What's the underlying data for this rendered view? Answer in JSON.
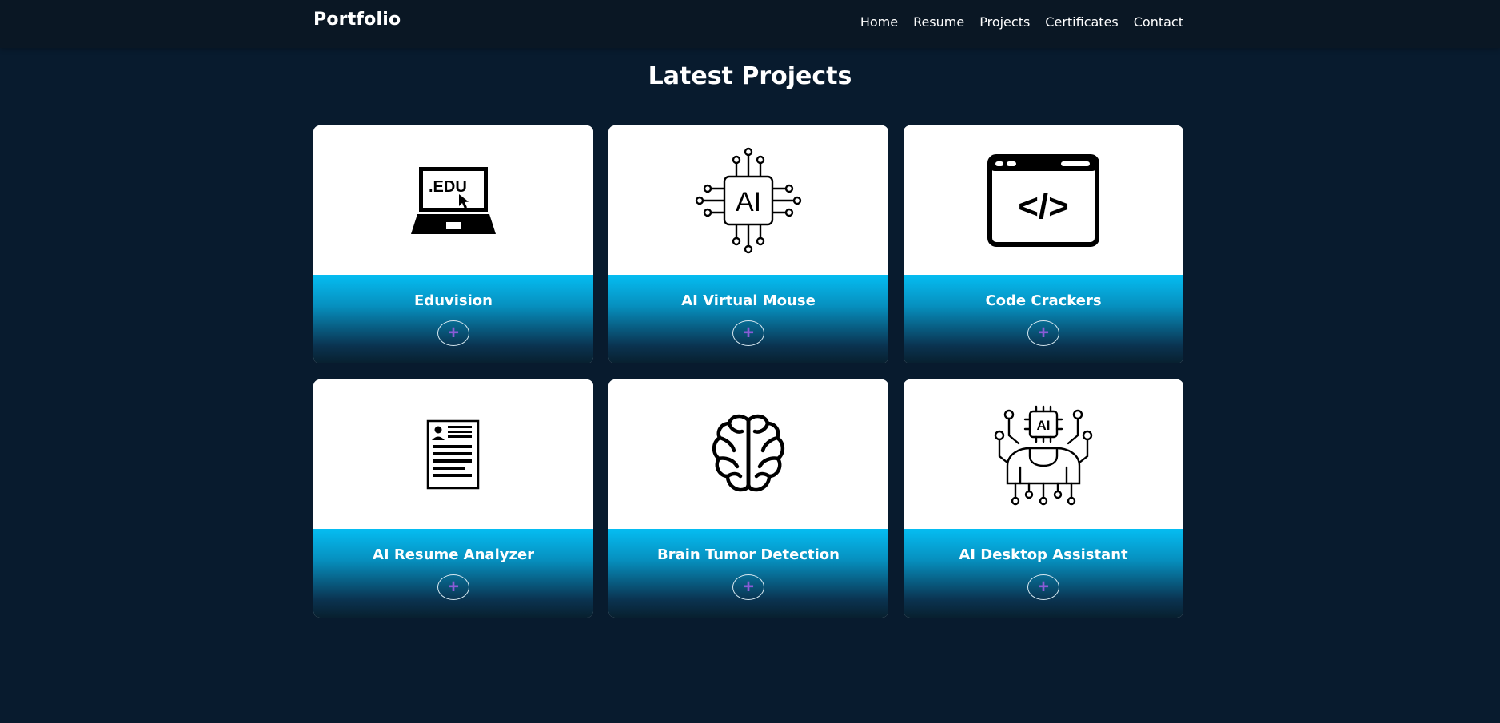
{
  "nav": {
    "brand": "Portfolio",
    "links": [
      "Home",
      "Resume",
      "Projects",
      "Certificates",
      "Contact"
    ]
  },
  "page": {
    "title": "Latest Projects"
  },
  "projects": [
    {
      "title": "Eduvision",
      "icon": "laptop-edu-icon",
      "icon_text": ".EDU"
    },
    {
      "title": "AI Virtual Mouse",
      "icon": "ai-chip-icon",
      "icon_text": "AI"
    },
    {
      "title": "Code Crackers",
      "icon": "code-window-icon",
      "icon_text": "</>"
    },
    {
      "title": "AI Resume Analyzer",
      "icon": "resume-document-icon"
    },
    {
      "title": "Brain Tumor Detection",
      "icon": "brain-icon"
    },
    {
      "title": "AI Desktop Assistant",
      "icon": "ai-robot-icon",
      "icon_text": "AI"
    }
  ],
  "card_button": {
    "label": "+"
  },
  "colors": {
    "background": "#081b2e",
    "navbar": "#0a1724",
    "card_gradient_top": "#05bdf2",
    "card_gradient_bottom": "#08202f",
    "plus_color": "#8a5bd6"
  }
}
